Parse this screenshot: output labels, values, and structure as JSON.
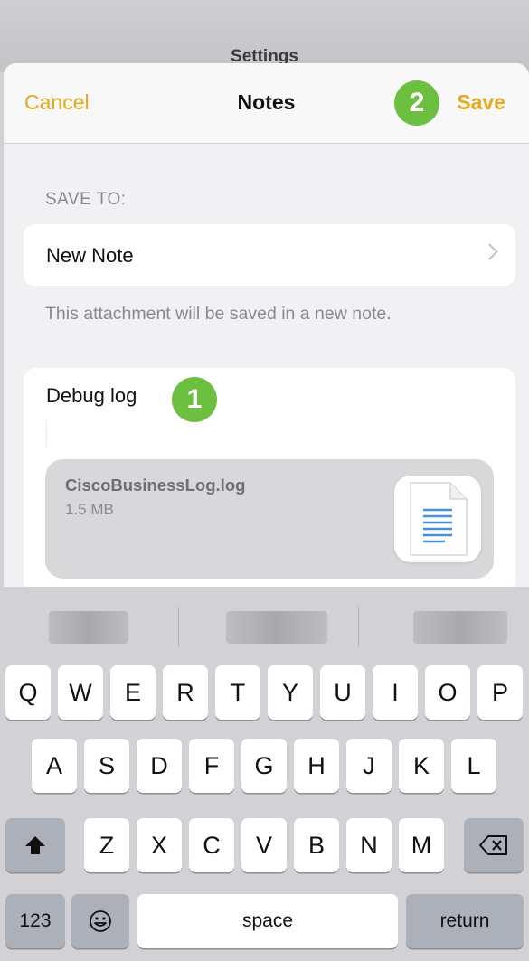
{
  "background_title": "Settings",
  "nav": {
    "cancel": "Cancel",
    "title": "Notes",
    "save": "Save"
  },
  "callouts": {
    "save_step": "2",
    "title_step": "1"
  },
  "save_to": {
    "label": "SAVE TO:",
    "destination": "New Note",
    "note": "This attachment will be saved in a new note."
  },
  "note": {
    "title": "Debug log",
    "attachment": {
      "name": "CiscoBusinessLog.log",
      "size": "1.5 MB",
      "icon": "document-icon"
    }
  },
  "keyboard": {
    "row1": [
      "Q",
      "W",
      "E",
      "R",
      "T",
      "Y",
      "U",
      "I",
      "O",
      "P"
    ],
    "row2": [
      "A",
      "S",
      "D",
      "F",
      "G",
      "H",
      "J",
      "K",
      "L"
    ],
    "row3": [
      "Z",
      "X",
      "C",
      "V",
      "B",
      "N",
      "M"
    ],
    "numbers": "123",
    "space": "space",
    "return": "return"
  },
  "colors": {
    "accent": "#E5A91F",
    "callout": "#6CBF3F"
  }
}
